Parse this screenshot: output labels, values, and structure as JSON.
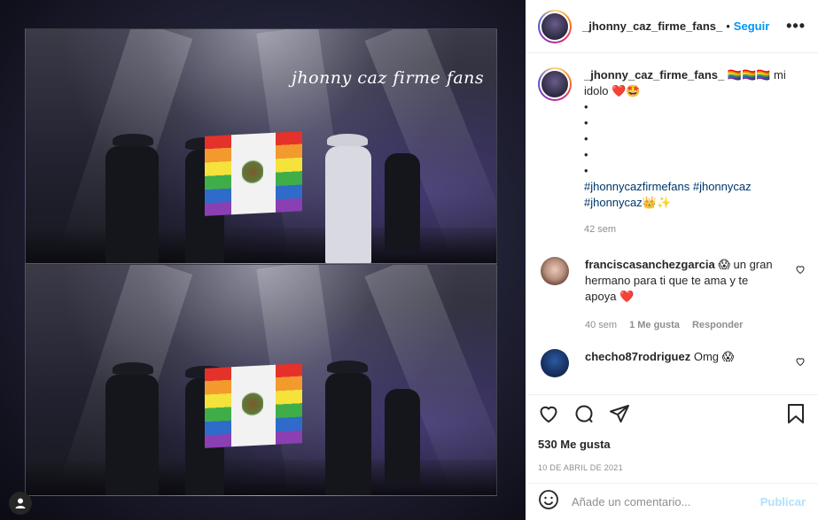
{
  "post": {
    "watermark": "jhonny caz firme fans",
    "author": "_jhonny_caz_firme_fans_",
    "follow_label": "Seguir",
    "separator": "•",
    "more_label": "•••",
    "caption": {
      "username": "_jhonny_caz_firme_fans_",
      "text_line1": "🏳️‍🌈🏳️‍🌈🏳️‍🌈 mi",
      "text_line2": "idolo ❤️🤩",
      "bullets": [
        "•",
        "•",
        "•",
        "•",
        "•"
      ],
      "hashtags_line1": "#jhonnycazfirmefans #jhonnycaz",
      "hashtags_line2": "#jhonnycaz👑✨",
      "time": "42 sem"
    },
    "comments": [
      {
        "username": "franciscasanchezgarcia",
        "text": "😱 un gran hermano para ti que te ama y te apoya ❤️",
        "time": "40 sem",
        "likes": "1 Me gusta",
        "reply": "Responder"
      },
      {
        "username": "checho87rodriguez",
        "text": "Omg 😱"
      }
    ],
    "likes": "530 Me gusta",
    "date": "10 DE ABRIL DE 2021",
    "comment_placeholder": "Añade un comentario...",
    "publish_label": "Publicar"
  },
  "colors": {
    "accent": "#0095f6",
    "hashtag": "#00376b",
    "muted": "#8e8e8e",
    "publish_disabled": "#b2dffc"
  },
  "icons": [
    "heart-icon",
    "comment-icon",
    "share-icon",
    "bookmark-icon",
    "emoji-icon",
    "user-icon"
  ]
}
